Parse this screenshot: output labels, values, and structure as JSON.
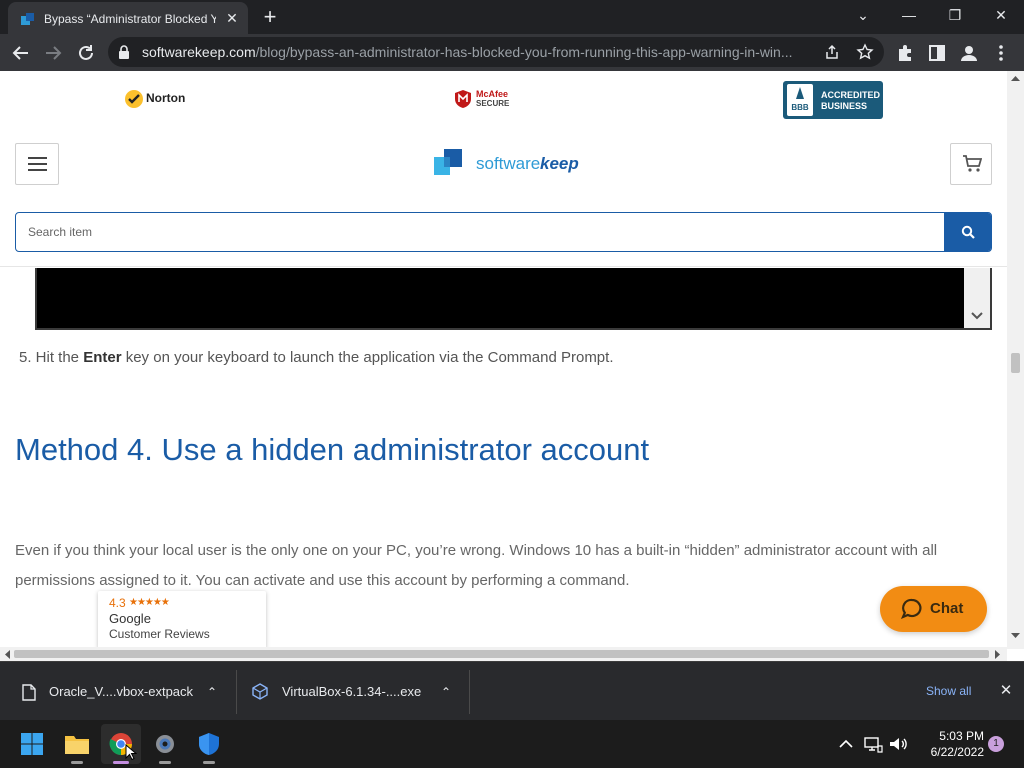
{
  "browser": {
    "tab_title": "Bypass “Administrator Blocked Y",
    "tab_close": "✕",
    "new_tab": "+",
    "url_host": "softwarekeep.com",
    "url_path": "/blog/bypass-an-administrator-has-blocked-you-from-running-this-app-warning-in-win...",
    "window_buttons": {
      "chevron": "⌄",
      "minimize": "—",
      "restore": "❐",
      "close": "✕"
    }
  },
  "header": {
    "badges": {
      "norton": "Norton",
      "mcafee_line1": "McAfee",
      "mcafee_line2": "SECURE",
      "bbb_line1": "ACCREDITED",
      "bbb_line2": "BUSINESS",
      "bbb_mark": "BBB"
    },
    "logo_part1": "software",
    "logo_part2": "keep",
    "search_placeholder": "Search item"
  },
  "article": {
    "step5_prefix": "5. Hit the ",
    "step5_bold": "Enter",
    "step5_suffix": " key on your keyboard to launch the application via the Command Prompt.",
    "heading": "Method 4. Use a hidden administrator account",
    "paragraph": "Even if you think your local user is the only one on your PC, you’re wrong. Windows 10 has a built-in “hidden” administrator account with all permissions assigned to it. You can activate and use this account by performing a command."
  },
  "review_widget": {
    "rating": "4.3",
    "stars": "★★★★★",
    "rating_fraction": 0.86,
    "source": "Google",
    "label": "Customer Reviews"
  },
  "chat": {
    "label": "Chat"
  },
  "downloads": {
    "items": [
      {
        "name": "Oracle_V....vbox-extpack",
        "icon": "file-icon"
      },
      {
        "name": "VirtualBox-6.1.34-....exe",
        "icon": "virtualbox-icon"
      }
    ],
    "show_all": "Show all",
    "close": "✕"
  },
  "taskbar": {
    "time": "5:03 PM",
    "date": "6/22/2022",
    "notifications": "1",
    "apps": [
      "start-icon",
      "file-explorer-icon",
      "chrome-icon",
      "settings-icon",
      "defender-icon"
    ]
  },
  "colors": {
    "brand_blue": "#1a5ca6",
    "chat_orange": "#f28c13",
    "link_blue": "#8ab4f8"
  }
}
